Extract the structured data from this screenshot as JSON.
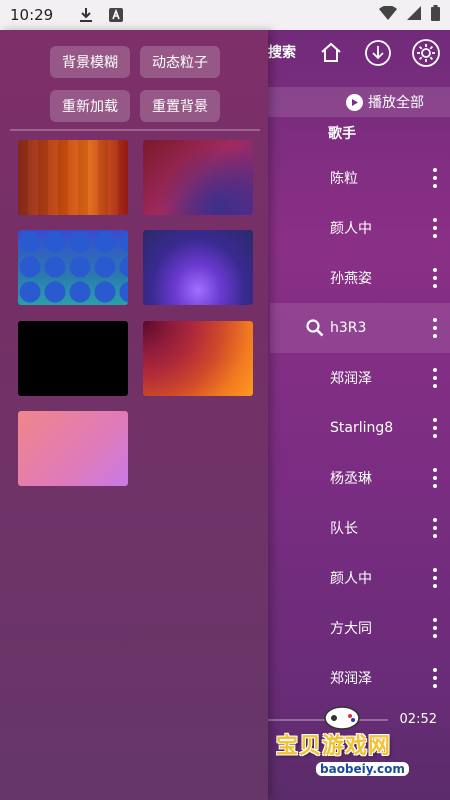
{
  "status_bar": {
    "time": "10:29"
  },
  "header": {
    "search_label": "搜索",
    "play_all": "播放全部",
    "artist_column": "歌手"
  },
  "rows": [
    {
      "name": "陈粒"
    },
    {
      "name": "颜人中"
    },
    {
      "name": "孙燕姿"
    },
    {
      "name": "h3R3"
    },
    {
      "name": "郑润泽"
    },
    {
      "name": "Starling8"
    },
    {
      "name": "杨丞琳"
    },
    {
      "name": "队长"
    },
    {
      "name": "颜人中"
    },
    {
      "name": "方大同"
    },
    {
      "name": "郑润泽"
    }
  ],
  "player": {
    "duration": "02:52"
  },
  "watermark": {
    "text": "宝贝游戏网",
    "url": "baobeiy.com"
  },
  "drawer": {
    "buttons": {
      "blur_bg": "背景模糊",
      "dynamic_particles": "动态粒子",
      "reload": "重新加载",
      "reset_bg": "重置背景"
    },
    "backgrounds": [
      "orange-stripes",
      "wine-purple",
      "blue-circles",
      "violet-glow",
      "black",
      "sunset-rings",
      "pink-gradient"
    ]
  },
  "colors": {
    "accent": "#8a2f86",
    "watermark_gold": "#f2c230"
  }
}
